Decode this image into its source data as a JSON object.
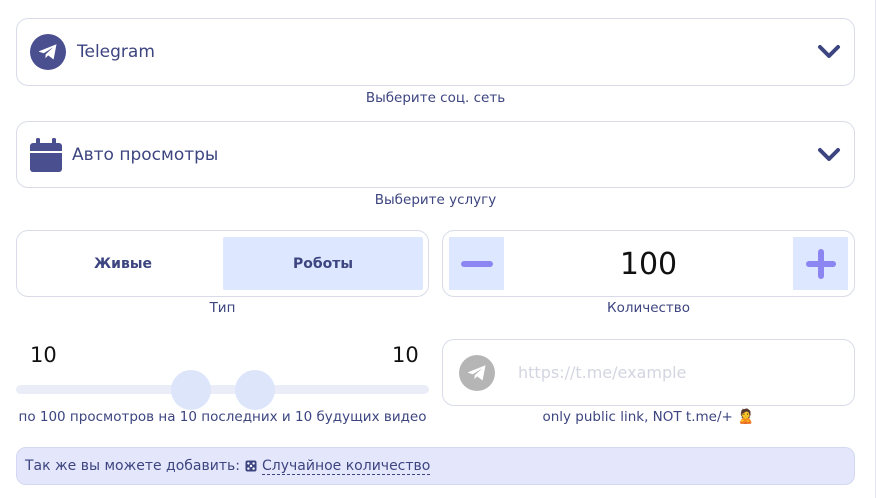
{
  "social": {
    "selected": "Telegram",
    "hint": "Выберите соц. сеть",
    "icon": "telegram-icon"
  },
  "service": {
    "selected": "Авто просмотры",
    "hint": "Выберите услугу",
    "icon": "calendar-icon"
  },
  "type": {
    "options": [
      "Живые",
      "Роботы"
    ],
    "selected": "Роботы",
    "hint": "Тип"
  },
  "quantity": {
    "value": "100",
    "hint": "Количество"
  },
  "range": {
    "min": "10",
    "max": "10",
    "hint": "по 100 просмотров на 10 последних и 10 будущих видео"
  },
  "link": {
    "placeholder": "https://t.me/example",
    "value": "",
    "hint": "only public link, NOT t.me/+",
    "hint_emoji": "🙎"
  },
  "extra": {
    "text": "Так же вы можете добавить:",
    "link_label": "Случайное количество"
  },
  "colors": {
    "accent": "#4a4f8f",
    "selected_bg": "#dde7ff",
    "plus_minus": "#8b86f2",
    "text": "#3d4580"
  }
}
